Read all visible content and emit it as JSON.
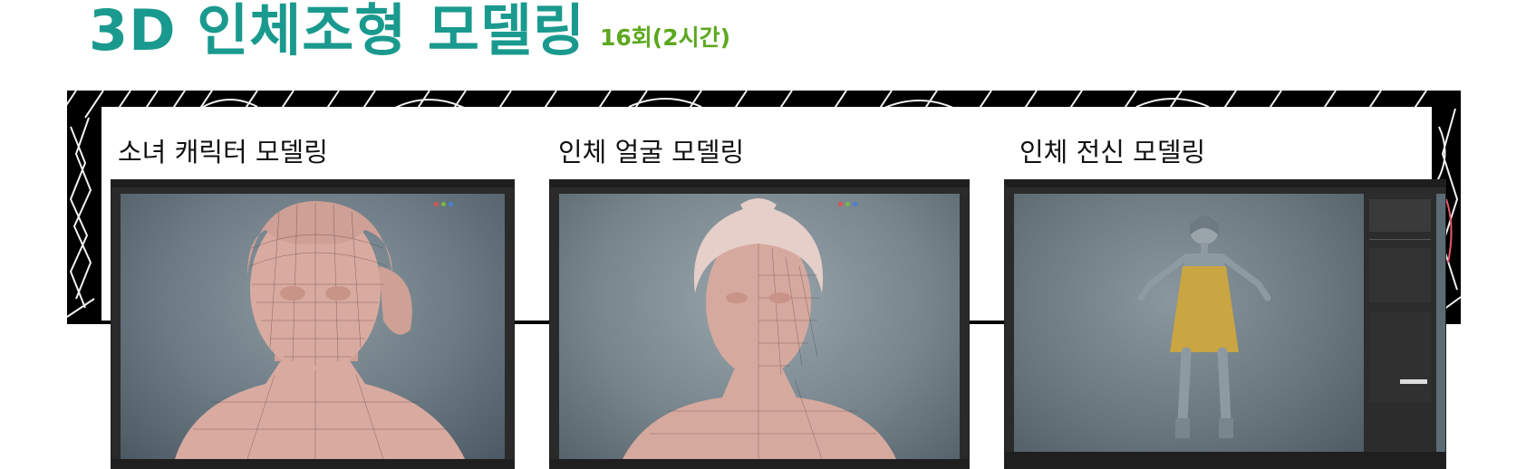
{
  "colors": {
    "accent": "#1a9a8e",
    "subtitle": "#5ca81e",
    "skin": "#d9aba0",
    "dress": "#c9a543"
  },
  "header": {
    "title": "3D 인체조형 모델링",
    "subtitle": "16회(2시간)"
  },
  "sections": [
    {
      "caption": "소녀 캐릭터 모델링",
      "viewport_icon": "girl-head-wireframe"
    },
    {
      "caption": "인체 얼굴 모델링",
      "viewport_icon": "face-wireframe"
    },
    {
      "caption": "인체 전신 모델링",
      "viewport_icon": "full-body-dress-model"
    }
  ]
}
